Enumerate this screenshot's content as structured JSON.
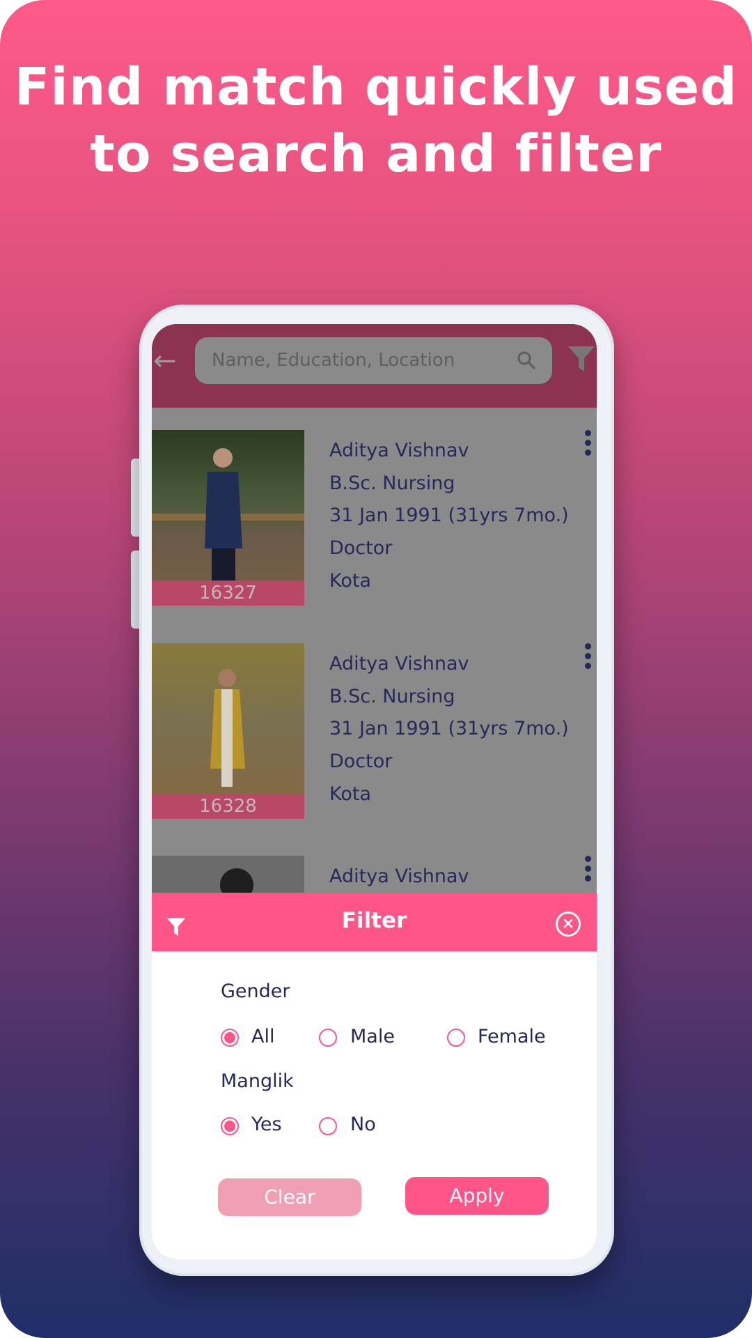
{
  "headline": {
    "line1": "Find match quickly used",
    "line2": "to search and filter"
  },
  "colors": {
    "accent": "#ff5588",
    "text": "#27285a",
    "appbar_dimmed": "#8b3350"
  },
  "search": {
    "placeholder": "Name, Education, Location",
    "icon": "search-icon"
  },
  "profiles": [
    {
      "id": "16327",
      "name": "Aditya Vishnav",
      "education": "B.Sc. Nursing",
      "dob": "31 Jan 1991 (31yrs 7mo.)",
      "occupation": "Doctor",
      "city": "Kota"
    },
    {
      "id": "16328",
      "name": "Aditya Vishnav",
      "education": "B.Sc. Nursing",
      "dob": "31 Jan 1991 (31yrs 7mo.)",
      "occupation": "Doctor",
      "city": "Kota"
    },
    {
      "name": "Aditya Vishnav"
    }
  ],
  "filter": {
    "title": "Filter",
    "gender": {
      "label": "Gender",
      "options": [
        "All",
        "Male",
        "Female"
      ],
      "selected": "All"
    },
    "manglik": {
      "label": "Manglik",
      "options": [
        "Yes",
        "No"
      ],
      "selected": "Yes"
    },
    "clear_label": "Clear",
    "apply_label": "Apply"
  }
}
